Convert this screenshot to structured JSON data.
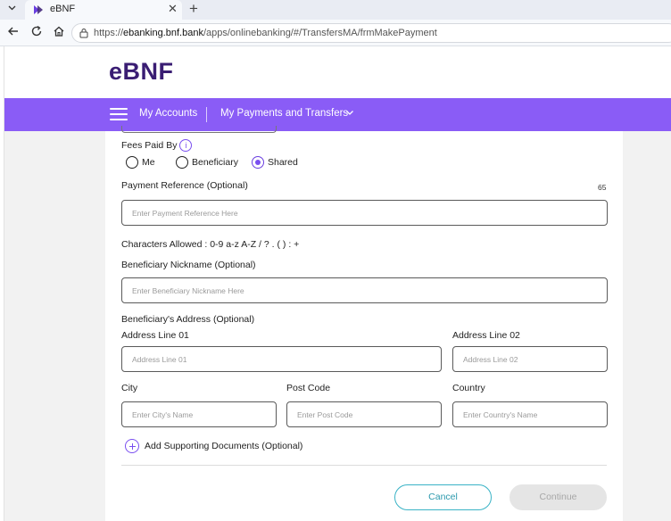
{
  "browser": {
    "tab_title": "eBNF",
    "url_prefix": "https://",
    "url_host": "ebanking.bnf.bank",
    "url_path": "/apps/onlinebanking/#/TransfersMA/frmMakePayment"
  },
  "brand": {
    "logo_text": "eBNF"
  },
  "nav": {
    "my_accounts": "My Accounts",
    "my_payments": "My Payments and Transfers"
  },
  "form": {
    "fees_paid_by_label": "Fees Paid By",
    "fees_options": [
      "Me",
      "Beneficiary",
      "Shared"
    ],
    "fees_selected": "Shared",
    "payment_reference_label": "Payment Reference (Optional)",
    "payment_reference_counter": "65",
    "payment_reference_placeholder": "Enter Payment Reference Here",
    "characters_allowed": "Characters Allowed : 0-9 a-z A-Z / ? . ( ) : +",
    "nickname_label": "Beneficiary Nickname (Optional)",
    "nickname_placeholder": "Enter Beneficiary Nickname Here",
    "address_section_label": "Beneficiary's Address (Optional)",
    "address1_label": "Address Line 01",
    "address1_placeholder": "Address Line 01",
    "address2_label": "Address Line 02",
    "address2_placeholder": "Address Line 02",
    "city_label": "City",
    "city_placeholder": "Enter City's Name",
    "postcode_label": "Post Code",
    "postcode_placeholder": "Enter Post Code",
    "country_label": "Country",
    "country_placeholder": "Enter Country's Name",
    "add_documents_label": "Add Supporting Documents (Optional)",
    "cancel_label": "Cancel",
    "continue_label": "Continue"
  },
  "colors": {
    "navbar": "#8a5cf6",
    "brand": "#3a1d73",
    "accent": "#7a4ff0",
    "cancel": "#3ab3c6"
  }
}
